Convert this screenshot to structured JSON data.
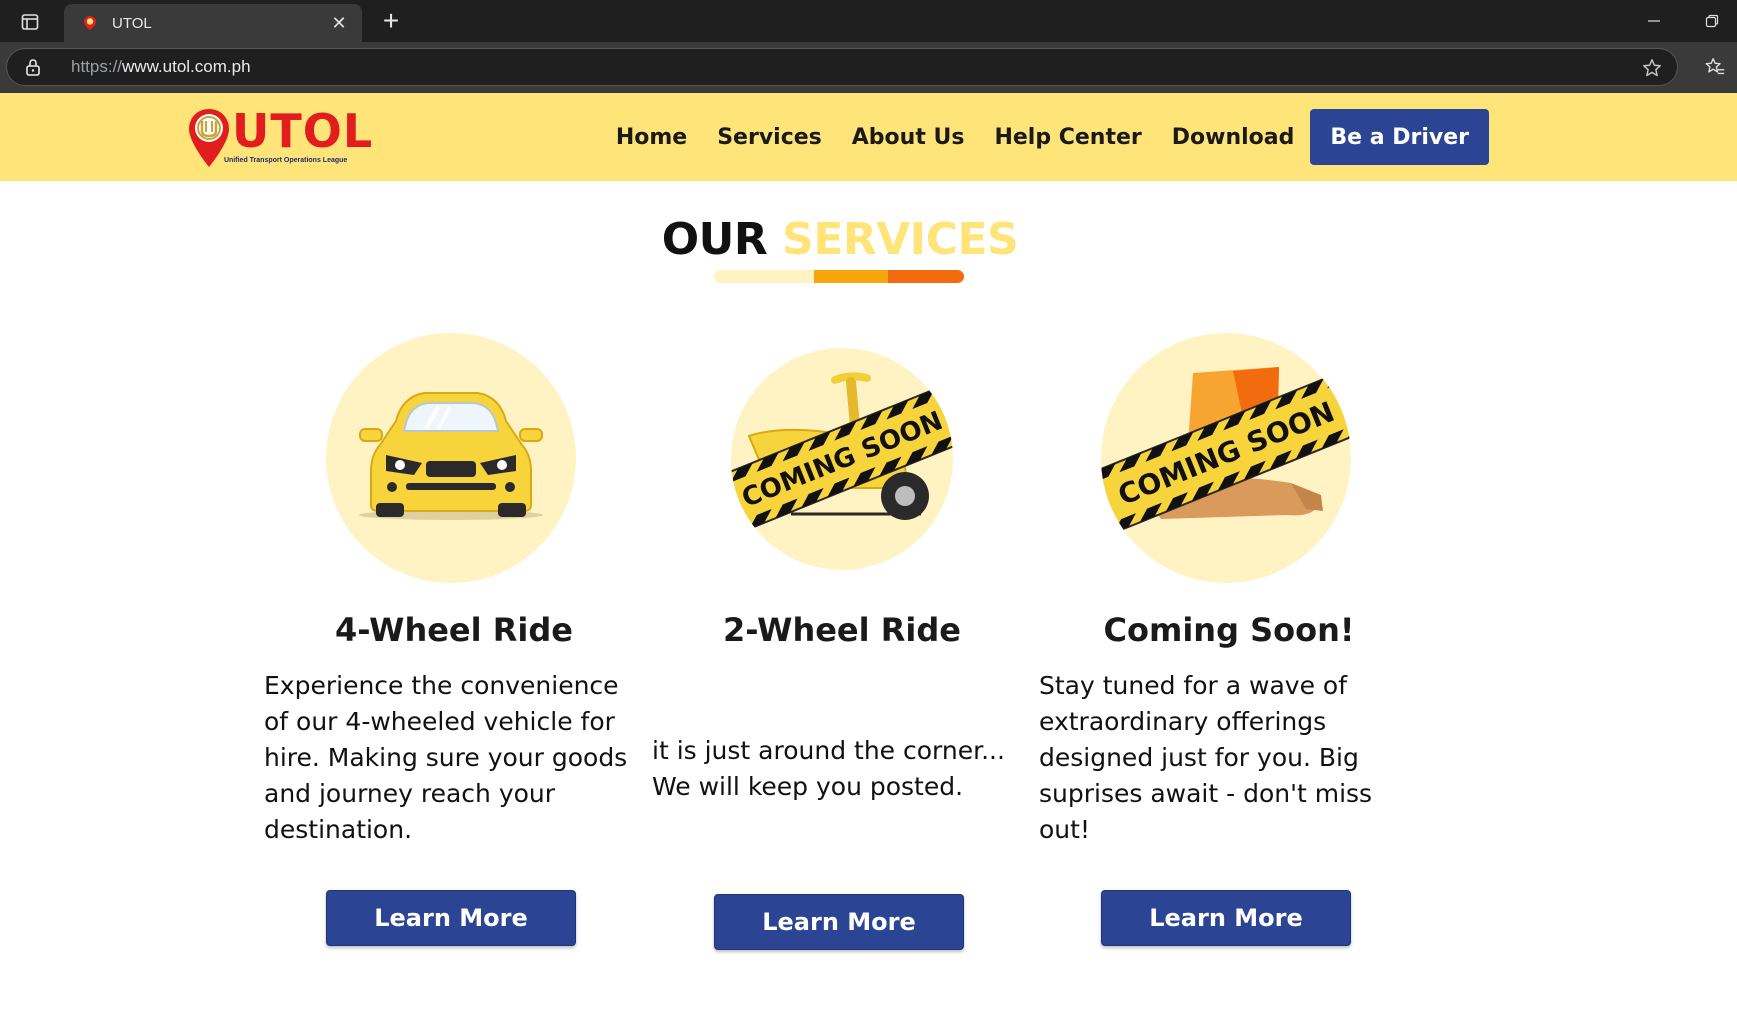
{
  "browser": {
    "tab_title": "UTOL",
    "url_protocol": "https://",
    "url_host": "www.utol.com.ph"
  },
  "site": {
    "logo_text": "UTOL",
    "logo_subtitle": "Unified Transport Operations League",
    "nav": {
      "home": "Home",
      "services": "Services",
      "about": "About Us",
      "help": "Help Center",
      "download": "Download",
      "driver_cta": "Be a Driver"
    }
  },
  "section": {
    "title_part1": "OUR",
    "title_part2": "SERVICES",
    "bar_colors": [
      "#fff3c4",
      "#f7a50c",
      "#f26b0f"
    ]
  },
  "banner_text": "COMING SOON",
  "services": [
    {
      "title": "4-Wheel Ride",
      "description": "Experience the convenience of our 4-wheeled vehicle for hire. Making sure your goods and journey reach your destination.",
      "button": "Learn More",
      "icon": "car-icon"
    },
    {
      "title": "2-Wheel Ride",
      "description": "it is just around the corner... We will keep you posted.",
      "button": "Learn More",
      "icon": "scooter-icon"
    },
    {
      "title": "Coming Soon!",
      "description": "Stay tuned for a wave of extraordinary offerings designed just for you. Big suprises await - don't miss out!",
      "button": "Learn More",
      "icon": "delivery-box-icon"
    }
  ],
  "colors": {
    "header_bg": "#ffe47a",
    "primary_button": "#2b4494",
    "circle_bg": "#fff3c4",
    "logo_red": "#e11d1d"
  }
}
